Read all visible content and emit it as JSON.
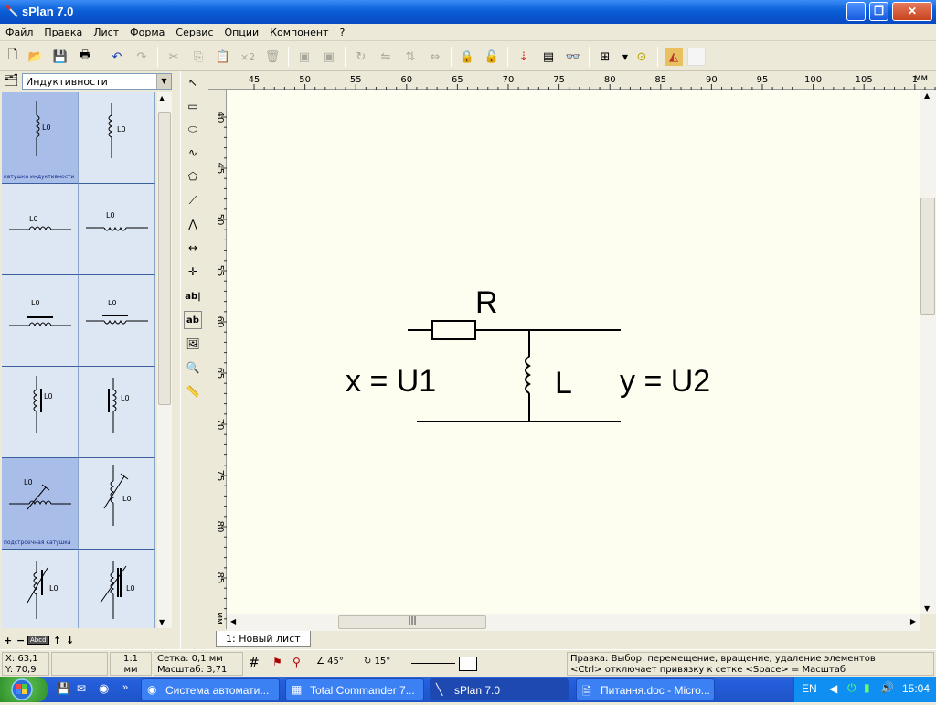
{
  "window": {
    "title": "sPlan 7.0"
  },
  "menu": [
    "Файл",
    "Правка",
    "Лист",
    "Форма",
    "Сервис",
    "Опции",
    "Компонент",
    "?"
  ],
  "toolbar": {
    "x2_label": "×2"
  },
  "library": {
    "selected": "Индуктивности",
    "cells": [
      {
        "label": "L0",
        "caption": "катушка индуктивности"
      },
      {
        "label": "L0",
        "caption": ""
      },
      {
        "label": "L0",
        "caption": ""
      },
      {
        "label": "L0",
        "caption": ""
      },
      {
        "label": "L0",
        "caption": ""
      },
      {
        "label": "L0",
        "caption": ""
      },
      {
        "label": "L0",
        "caption": ""
      },
      {
        "label": "L0",
        "caption": ""
      },
      {
        "label": "L0",
        "caption": "подстроечная катушка"
      },
      {
        "label": "L0",
        "caption": ""
      },
      {
        "label": "L0",
        "caption": ""
      },
      {
        "label": "L0",
        "caption": ""
      }
    ],
    "bottom": {
      "plus": "+",
      "minus": "−",
      "abcd": "Abcd",
      "up": "↑",
      "down": "↓"
    }
  },
  "tools": {
    "text_tool1": "ab|",
    "text_tool2": "ab"
  },
  "ruler": {
    "h_ticks": [
      "45",
      "50",
      "55",
      "60",
      "65",
      "70",
      "75",
      "80",
      "85",
      "90",
      "95",
      "100",
      "105",
      "1"
    ],
    "h_unit": "мм",
    "v_ticks": [
      "40",
      "45",
      "50",
      "55",
      "60",
      "65",
      "70",
      "75",
      "80",
      "85"
    ],
    "v_unit": "мм"
  },
  "schematic": {
    "R_label": "R",
    "L_label": "L",
    "input_label": "x = U1",
    "output_label": "y = U2"
  },
  "sheet": {
    "tab": "1: Новый лист"
  },
  "status": {
    "x": "X: 63,1",
    "y": "Y: 70,9",
    "scale_ratio": "1:1",
    "scale_unit": "мм",
    "grid": "Сетка: 0,1 мм",
    "zoom": "Масштаб: 3,71",
    "angle1": "45°",
    "angle2": "15°",
    "hint1": "Правка: Выбор, перемещение, вращение, удаление элементов",
    "hint2": "<Ctrl> отключает привязку к сетке <Space> = Масштаб"
  },
  "taskbar": {
    "tasks": [
      "Система автомати...",
      "Total Commander 7...",
      "sPlan 7.0",
      "Питання.doc - Micro..."
    ],
    "lang": "EN",
    "clock": "15:04"
  },
  "colors": {
    "canvas": "#fefef0",
    "title_blue": "#0a5fd8",
    "selected_cell": "#a8bde8"
  }
}
